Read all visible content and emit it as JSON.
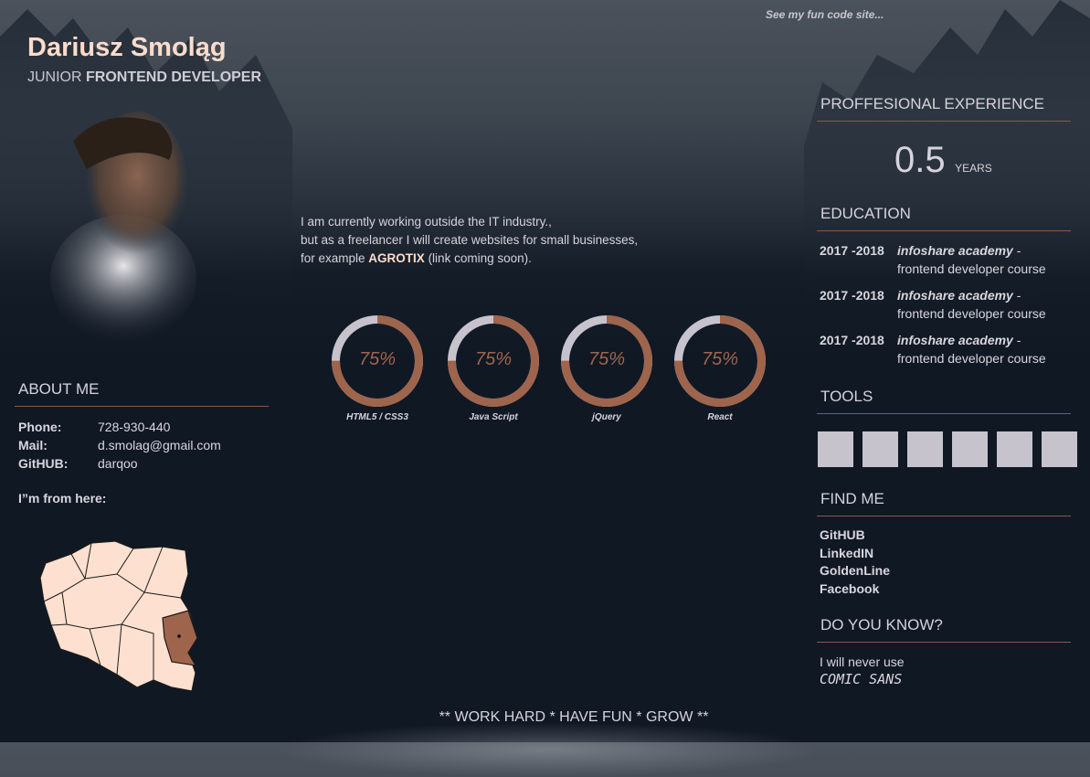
{
  "header": {
    "name": "Dariusz Smoląg",
    "role_light": "JUNIOR",
    "role_bold": "FRONTEND DEVELOPER",
    "fun_link": "See my fun code site..."
  },
  "intro": {
    "line1": "I am currently working outside the IT industry.,",
    "line2": "but as a freelancer I will create websites for small businesses,",
    "line3_pre": "for example ",
    "line3_link": "AGROTIX",
    "line3_post": " (link coming soon)."
  },
  "about": {
    "title": "ABOUT ME",
    "phone_label": "Phone:",
    "phone": "728-930-440",
    "mail_label": "Mail:",
    "mail": "d.smolag@gmail.com",
    "github_label": "GitHUB:",
    "github": "darqoo",
    "from": "I”m from here:"
  },
  "skills": [
    {
      "label": "HTML5 / CSS3",
      "percent": 75,
      "text": "75%"
    },
    {
      "label": "Java Script",
      "percent": 75,
      "text": "75%"
    },
    {
      "label": "jQuery",
      "percent": 75,
      "text": "75%"
    },
    {
      "label": "React",
      "percent": 75,
      "text": "75%"
    }
  ],
  "experience": {
    "title": "PROFFESIONAL EXPERIENCE",
    "value": "0.5",
    "unit": "YEARS"
  },
  "education": {
    "title": "EDUCATION",
    "items": [
      {
        "years": "2017 -2018",
        "school": "infoshare academy",
        "sep": " -",
        "course": "frontend developer course"
      },
      {
        "years": "2017 -2018",
        "school": "infoshare academy",
        "sep": " -",
        "course": "frontend developer course"
      },
      {
        "years": "2017 -2018",
        "school": "infoshare academy",
        "sep": " -",
        "course": "frontend developer course"
      }
    ]
  },
  "tools": {
    "title": "TOOLS",
    "count": 6
  },
  "find": {
    "title": "FIND ME",
    "links": [
      "GitHUB",
      "LinkedIN",
      "GoldenLine",
      "Facebook"
    ]
  },
  "know": {
    "title": "DO YOU KNOW?",
    "line1": "I will never use",
    "line2": "COMIC SANS"
  },
  "footer": "** WORK HARD * HAVE FUN * GROW **",
  "colors": {
    "accent": "#fcdccb",
    "ring": "#9e644c",
    "ring_bg": "#c6c3cc",
    "bg": "#101824"
  }
}
